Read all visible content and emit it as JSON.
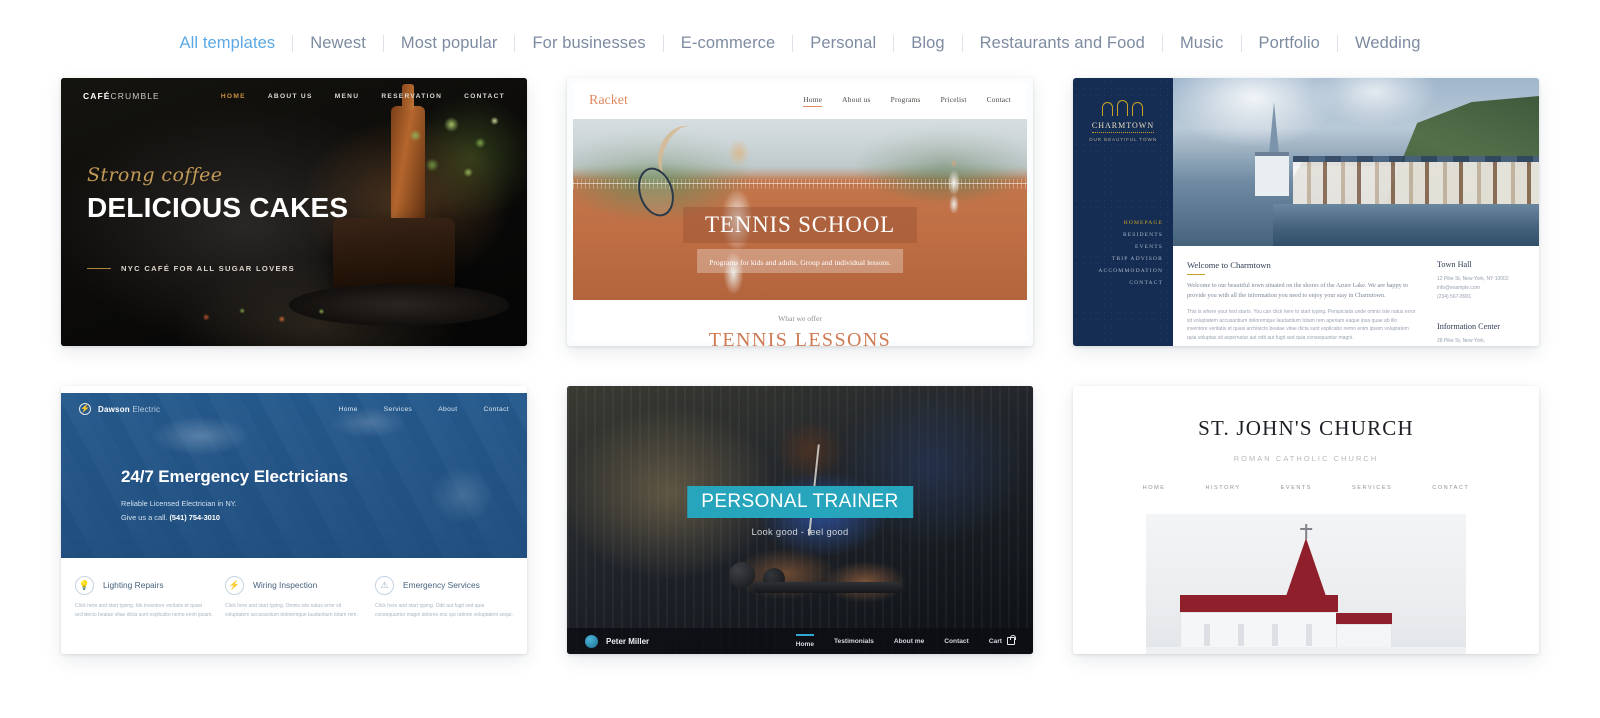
{
  "filters": [
    {
      "label": "All templates",
      "active": true
    },
    {
      "label": "Newest",
      "active": false
    },
    {
      "label": "Most popular",
      "active": false
    },
    {
      "label": "For businesses",
      "active": false
    },
    {
      "label": "E-commerce",
      "active": false
    },
    {
      "label": "Personal",
      "active": false
    },
    {
      "label": "Blog",
      "active": false
    },
    {
      "label": "Restaurants and Food",
      "active": false
    },
    {
      "label": "Music",
      "active": false
    },
    {
      "label": "Portfolio",
      "active": false
    },
    {
      "label": "Wedding",
      "active": false
    }
  ],
  "colors": {
    "active_filter": "#5aa9e6",
    "filter_text": "#7d8ba1",
    "cafe_gold": "#c29a57",
    "racket_salmon": "#e08a63",
    "charm_navy": "#152d52",
    "charm_gold": "#c9a227",
    "dawson_blue": "#2a6496",
    "trainer_teal": "#27a5bd",
    "church_red": "#8e1f2b"
  },
  "templates": {
    "cafe": {
      "logo_bold": "CAFÉ",
      "logo_light": "CRUMBLE",
      "menu": [
        "HOME",
        "ABOUT US",
        "MENU",
        "RESERVATION",
        "CONTACT"
      ],
      "script": "Strong coffee",
      "title": "DELICIOUS CAKES",
      "tagline": "NYC CAFÉ FOR ALL SUGAR LOVERS"
    },
    "racket": {
      "logo": "Racket",
      "menu": [
        "Home",
        "About us",
        "Programs",
        "Pricelist",
        "Contact"
      ],
      "hero_title": "TENNIS SCHOOL",
      "hero_sub": "Programs for kids and adults. Group and individual lessons.",
      "section_kicker": "What we offer",
      "section_title": "TENNIS LESSONS"
    },
    "charmtown": {
      "logo": "CHARMTOWN",
      "logo_sub": "OUR BEAUTIFUL TOWN",
      "menu": [
        "HOMEPAGE",
        "RESIDENTS",
        "EVENTS",
        "TRIP ADVISOR",
        "ACCOMMODATION",
        "CONTACT"
      ],
      "heading": "Welcome to Charmtown",
      "lede": "Welcome to our beautiful town situated on the shores of the Azure Lake. We are happy to provide you with all the information you need to enjoy your stay in Charmtown.",
      "body": "This is where your text starts. You can click here to start typing. Perspiciatis unde omnis iste natus error sit voluptatem accusantium doloremque laudantium totam rem aperiam eaque ipsa quae ab illo inventore veritatis et quasi architecto beatae vitae dicta sunt explicabo nemo enim ipsam voluptatem quia voluptas sit aspernatur aut odit aut fugit sed quia consequuntur magni.",
      "aside": [
        {
          "title": "Town Hall",
          "lines": [
            "12 Pike St, New York, NY 10002",
            "info@example.com",
            "(234) 567-8901"
          ]
        },
        {
          "title": "Information Center",
          "lines": [
            "28 Pike St, New York,"
          ]
        }
      ]
    },
    "dawson": {
      "logo_bold": "Dawson",
      "logo_light": "Electric",
      "logo_icon": "bolt-icon",
      "menu": [
        "Home",
        "Services",
        "About",
        "Contact"
      ],
      "title": "24/7 Emergency Electricians",
      "sub_line1": "Reliable Licensed Electrician in NY.",
      "sub_line2_pre": "Give us a call. ",
      "phone": "(541) 754-3010",
      "features": [
        {
          "icon": "lightbulb-icon",
          "title": "Lighting Repairs",
          "body": "Click here and start typing. Ido inventore veritatis et quasi architecto beatae vitae dicta sunt explicabo nemo enim ipsam."
        },
        {
          "icon": "plug-icon",
          "title": "Wiring Inspection",
          "body": "Click here and start typing. Omnis iste natus error sit voluptatem accusantium doloremque laudantium totam rem."
        },
        {
          "icon": "alert-icon",
          "title": "Emergency Services",
          "body": "Click here and start typing. Odit aut fugit sed quia consequuntur magni dolores eos qui ratione voluptatem sequi."
        }
      ]
    },
    "trainer": {
      "banner": "PERSONAL TRAINER",
      "tagline": "Look good - feel good",
      "name": "Peter Miller",
      "menu": [
        "Home",
        "Testimonials",
        "About me",
        "Contact"
      ],
      "cart_label": "Cart"
    },
    "church": {
      "title": "ST. JOHN'S CHURCH",
      "subtitle": "ROMAN CATHOLIC CHURCH",
      "menu": [
        "HOME",
        "HISTORY",
        "EVENTS",
        "SERVICES",
        "CONTACT"
      ]
    }
  }
}
